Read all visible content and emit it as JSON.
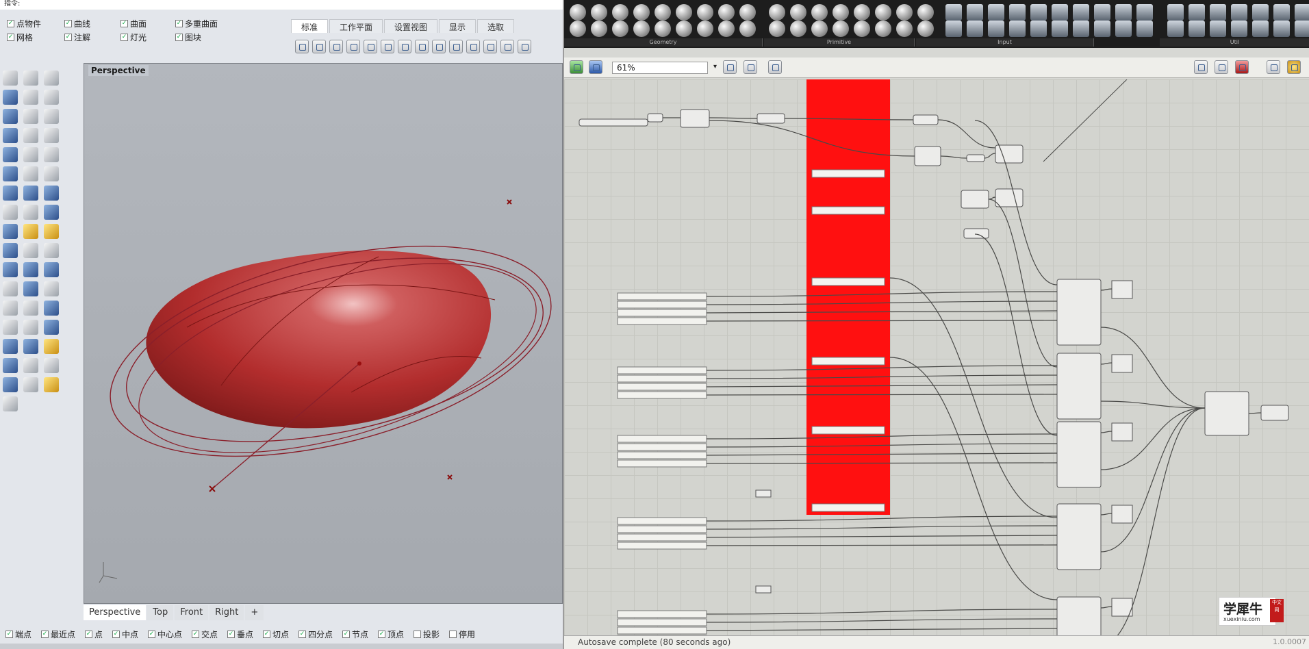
{
  "rhino": {
    "title": "指令:",
    "osnap_top": [
      "点物件",
      "曲线",
      "曲面",
      "多重曲面",
      "网格",
      "注解",
      "灯光",
      "图块"
    ],
    "tabs": [
      "标准",
      "工作平面",
      "设置视图",
      "显示",
      "选取"
    ],
    "viewport_label": "Perspective",
    "viewport_tabs": [
      "Perspective",
      "Top",
      "Front",
      "Right"
    ],
    "osnap_bottom": [
      "端点",
      "最近点",
      "点",
      "中点",
      "中心点",
      "交点",
      "垂点",
      "切点",
      "四分点",
      "节点",
      "顶点",
      "投影",
      "停用"
    ],
    "osnap_bottom_checked": [
      true,
      true,
      true,
      true,
      true,
      true,
      true,
      true,
      true,
      true,
      true,
      false,
      false
    ]
  },
  "gh": {
    "zoom": "61%",
    "ribbon_sections": [
      "Geometry",
      "Primitive",
      "Input",
      "Util"
    ],
    "status": "Autosave complete (80 seconds ago)",
    "version": "1.0.0007"
  },
  "watermark": {
    "title": "学犀牛",
    "url": "xuexiniu.com",
    "badge": "中文网"
  }
}
